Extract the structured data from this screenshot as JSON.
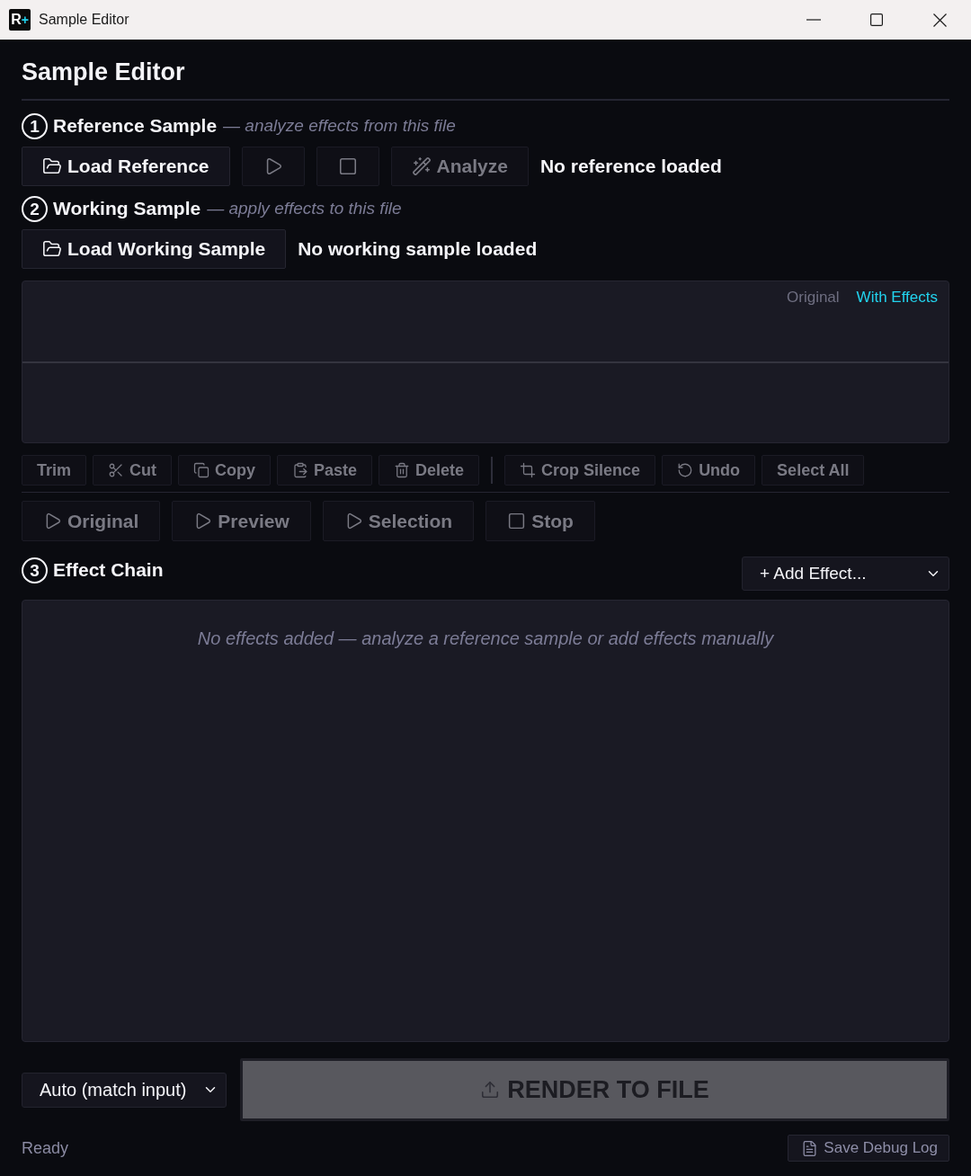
{
  "window": {
    "title": "Sample Editor",
    "logo": {
      "letter": "R",
      "accent": "+"
    }
  },
  "heading": "Sample Editor",
  "reference": {
    "number": "1",
    "title": "Reference Sample",
    "subtitle": "— analyze effects from this file",
    "buttons": [
      {
        "label": "Load Reference",
        "kind": "folder",
        "disabled": false
      },
      {
        "kind": "play",
        "disabled": true
      },
      {
        "kind": "stop",
        "disabled": true
      },
      {
        "label": "Analyze",
        "kind": "wand",
        "disabled": true
      }
    ],
    "status": "No reference loaded"
  },
  "working": {
    "number": "2",
    "title": "Working Sample",
    "subtitle": "— apply effects to this file",
    "buttons": [
      {
        "label": "Load Working Sample",
        "kind": "folder",
        "disabled": false
      }
    ],
    "status": "No working sample loaded"
  },
  "waveform": {
    "views": [
      {
        "label": "Original",
        "selected": false
      },
      {
        "label": "With Effects",
        "selected": true
      }
    ]
  },
  "edit_toolbar": {
    "groups": [
      {
        "buttons": [
          {
            "label": "Trim",
            "kind": "text",
            "disabled": true
          },
          {
            "label": "Cut",
            "kind": "scissors",
            "disabled": true
          },
          {
            "label": "Copy",
            "kind": "copy",
            "disabled": true
          },
          {
            "label": "Paste",
            "kind": "paste",
            "disabled": true
          },
          {
            "label": "Delete",
            "kind": "trash",
            "disabled": true
          }
        ]
      },
      {
        "buttons": [
          {
            "label": "Crop Silence",
            "kind": "crop",
            "disabled": true
          },
          {
            "label": "Undo",
            "kind": "undo",
            "disabled": true
          },
          {
            "label": "Select All",
            "kind": "text",
            "disabled": true
          }
        ]
      }
    ]
  },
  "playback": {
    "buttons": [
      {
        "label": "Original",
        "kind": "play",
        "disabled": true
      },
      {
        "label": "Preview",
        "kind": "play",
        "disabled": true
      },
      {
        "label": "Selection",
        "kind": "play",
        "disabled": true
      },
      {
        "label": "Stop",
        "kind": "stop",
        "disabled": true
      }
    ]
  },
  "effect_chain": {
    "number": "3",
    "title": "Effect Chain",
    "add_effect": {
      "value": "+ Add Effect..."
    },
    "empty_message": "No effects added — analyze a reference sample or add effects manually"
  },
  "footer": {
    "format": {
      "value": "Auto (match input)"
    },
    "render_button": {
      "label": "RENDER TO FILE",
      "disabled": true
    },
    "status": "Ready",
    "debug_button": {
      "label": "Save Debug Log"
    }
  }
}
